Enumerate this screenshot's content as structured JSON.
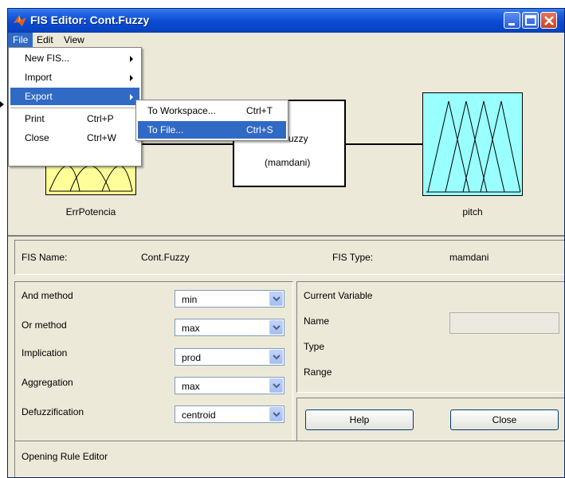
{
  "window": {
    "title": "FIS Editor: Cont.Fuzzy"
  },
  "menubar": {
    "items": [
      "File",
      "Edit",
      "View"
    ]
  },
  "file_menu": {
    "items": [
      {
        "label": "New FIS...",
        "shortcut": "",
        "submenu": true
      },
      {
        "label": "Import",
        "shortcut": "",
        "submenu": true
      },
      {
        "label": "Export",
        "shortcut": "",
        "submenu": true
      },
      {
        "label": "Print",
        "shortcut": "Ctrl+P",
        "submenu": false
      },
      {
        "label": "Close",
        "shortcut": "Ctrl+W",
        "submenu": false
      }
    ]
  },
  "export_submenu": {
    "items": [
      {
        "label": "To Workspace...",
        "shortcut": "Ctrl+T"
      },
      {
        "label": "To File...",
        "shortcut": "Ctrl+S"
      }
    ]
  },
  "diagram": {
    "input_name": "ErrPotencia",
    "system_name_partial": "uzzy",
    "system_type": "(mamdani)",
    "output_name": "pitch",
    "input_color": "#ffff99",
    "output_color": "#99ffff"
  },
  "fis_info": {
    "name_label": "FIS Name:",
    "name_value": "Cont.Fuzzy",
    "type_label": "FIS Type:",
    "type_value": "mamdani"
  },
  "methods": {
    "and_label": "And method",
    "and_value": "min",
    "or_label": "Or method",
    "or_value": "max",
    "implication_label": "Implication",
    "implication_value": "prod",
    "aggregation_label": "Aggregation",
    "aggregation_value": "max",
    "defuzz_label": "Defuzzification",
    "defuzz_value": "centroid"
  },
  "current_variable": {
    "title": "Current Variable",
    "name_label": "Name",
    "name_value": "",
    "type_label": "Type",
    "range_label": "Range"
  },
  "buttons": {
    "help": "Help",
    "close": "Close"
  },
  "status": {
    "text": "Opening Rule Editor"
  },
  "colors": {
    "title_blue": "#0845c7",
    "highlight": "#316ac5",
    "window_bg": "#ece9d8"
  }
}
